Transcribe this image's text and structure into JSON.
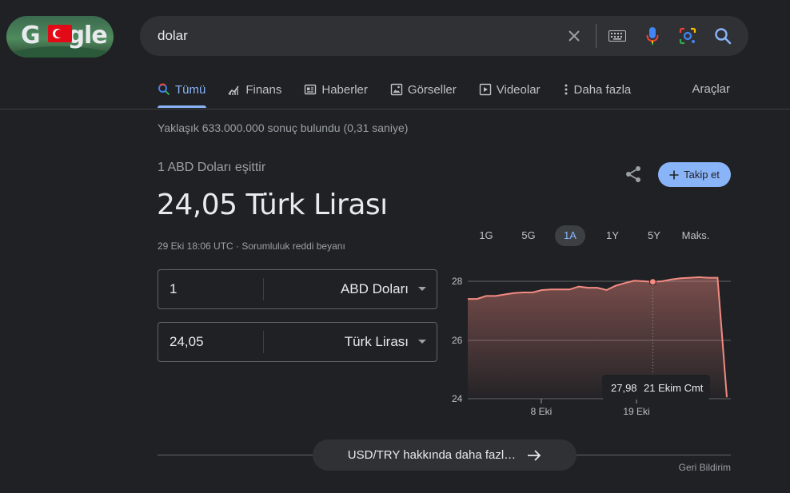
{
  "search": {
    "query": "dolar"
  },
  "tabs": [
    {
      "label": "Tümü",
      "icon": "search-icon"
    },
    {
      "label": "Finans",
      "icon": "finance-icon"
    },
    {
      "label": "Haberler",
      "icon": "news-icon"
    },
    {
      "label": "Görseller",
      "icon": "image-icon"
    },
    {
      "label": "Videolar",
      "icon": "video-icon"
    },
    {
      "label": "Daha fazla",
      "icon": "more-vert-icon"
    }
  ],
  "tools_label": "Araçlar",
  "result_stats": "Yaklaşık 633.000.000 sonuç bulundu (0,31 saniye)",
  "converter": {
    "equal_to": "1 ABD Doları eşittir",
    "result": "24,05 Türk Lirası",
    "timestamp": "29 Eki 18:06 UTC · Sorumluluk reddi beyanı",
    "from_amount": "1",
    "from_currency": "ABD Doları",
    "to_amount": "24,05",
    "to_currency": "Türk Lirası"
  },
  "follow_label": "Takip et",
  "ranges": [
    "1G",
    "5G",
    "1A",
    "1Y",
    "5Y",
    "Maks."
  ],
  "active_range": "1A",
  "chart_data": {
    "type": "area",
    "y_ticks": [
      "28",
      "26",
      "24"
    ],
    "x_ticks": [
      "8 Eki",
      "19 Eki"
    ],
    "ylim": [
      24,
      28
    ],
    "values": [
      27.4,
      27.4,
      27.5,
      27.5,
      27.55,
      27.6,
      27.62,
      27.62,
      27.7,
      27.72,
      27.72,
      27.72,
      27.82,
      27.78,
      27.78,
      27.7,
      27.85,
      27.94,
      28.02,
      28.0,
      27.98,
      28.0,
      28.06,
      28.1,
      28.12,
      28.14,
      28.12,
      28.12,
      24.05
    ],
    "tooltip": {
      "value": "27,98",
      "date": "21 Ekim Cmt"
    },
    "line_color": "#f28b82"
  },
  "more_button": "USD/TRY hakkında daha fazl…",
  "feedback": "Geri Bildirim"
}
